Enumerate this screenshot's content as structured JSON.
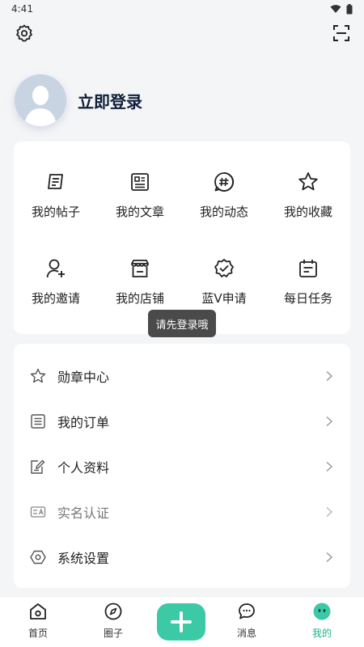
{
  "status": {
    "time": "4:41"
  },
  "profile": {
    "login_text": "立即登录"
  },
  "grid": {
    "items": [
      {
        "label": "我的帖子",
        "icon": "post-icon"
      },
      {
        "label": "我的文章",
        "icon": "article-icon"
      },
      {
        "label": "我的动态",
        "icon": "hashtag-icon"
      },
      {
        "label": "我的收藏",
        "icon": "star-icon"
      },
      {
        "label": "我的邀请",
        "icon": "invite-user-icon"
      },
      {
        "label": "我的店铺",
        "icon": "store-icon"
      },
      {
        "label": "蓝V申请",
        "icon": "verified-badge-icon"
      },
      {
        "label": "每日任务",
        "icon": "calendar-icon"
      }
    ]
  },
  "toast": {
    "text": "请先登录哦"
  },
  "list": {
    "items": [
      {
        "label": "勋章中心",
        "icon": "star-outline-icon"
      },
      {
        "label": "我的订单",
        "icon": "order-list-icon"
      },
      {
        "label": "个人资料",
        "icon": "edit-profile-icon"
      },
      {
        "label": "实名认证",
        "icon": "id-card-icon"
      },
      {
        "label": "系统设置",
        "icon": "hexagon-settings-icon"
      }
    ]
  },
  "nav": {
    "home": "首页",
    "circle": "圈子",
    "messages": "消息",
    "mine": "我的"
  },
  "colors": {
    "accent": "#3cc9a5",
    "active_text": "#1fb28a",
    "avatar_bg": "#c9d4e3"
  }
}
